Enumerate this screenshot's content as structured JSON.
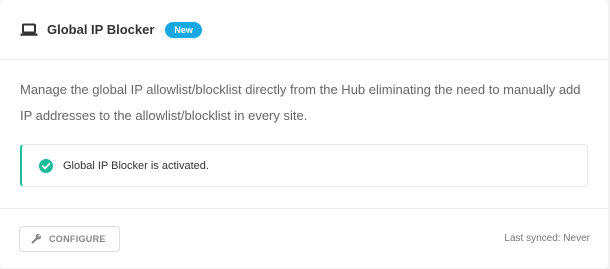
{
  "header": {
    "icon": "laptop-icon",
    "title": "Global IP Blocker",
    "badge": "New",
    "badge_color": "#17a8e3"
  },
  "body": {
    "description": "Manage the global IP allowlist/blocklist directly from the Hub eliminating the need to manually add IP addresses to the allowlist/blocklist in every site.",
    "notice": {
      "icon": "check-circle-icon",
      "text": "Global IP Blocker is activated.",
      "accent_color": "#1abc9c"
    }
  },
  "footer": {
    "configure_button": {
      "icon": "wrench-icon",
      "label": "CONFIGURE"
    },
    "last_synced": "Last synced: Never"
  }
}
